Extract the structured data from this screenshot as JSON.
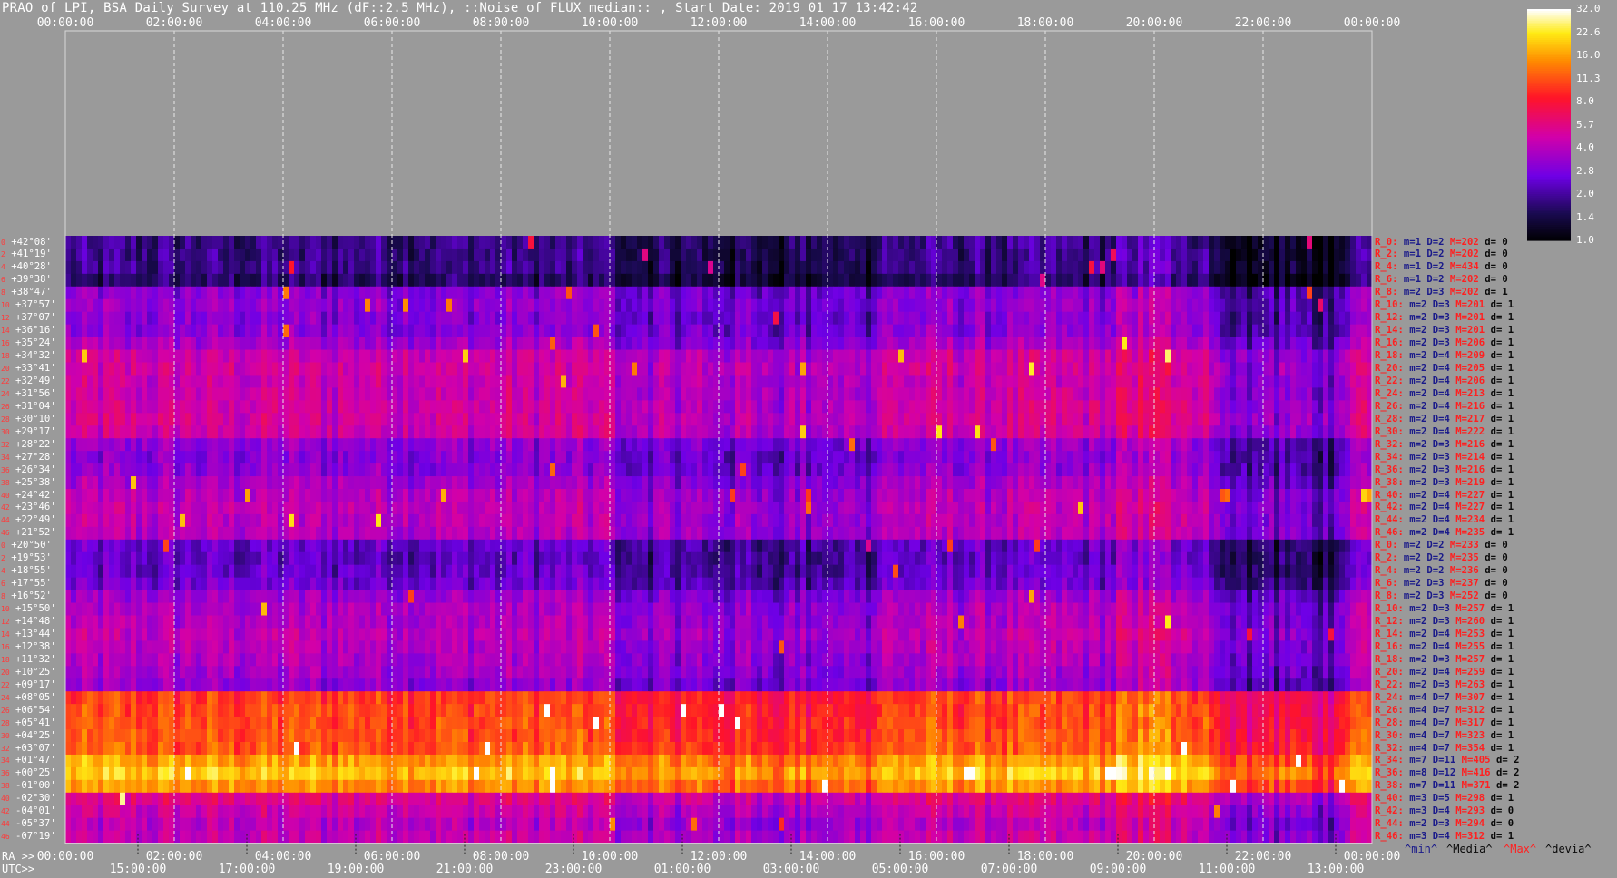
{
  "title": "PRAO of LPI, BSA Daily Survey at 110.25 MHz (dF::2.5 MHz), ::Noise_of_FLUX_median:: , Start Date: 2019 01 17 13:42:42",
  "axes": {
    "top_ticks": [
      "00:00:00",
      "02:00:00",
      "04:00:00",
      "06:00:00",
      "08:00:00",
      "10:00:00",
      "12:00:00",
      "14:00:00",
      "16:00:00",
      "18:00:00",
      "20:00:00",
      "22:00:00",
      "00:00:00"
    ],
    "ra_label": "RA >>",
    "ra_ticks": [
      "00:00:00",
      "02:00:00",
      "04:00:00",
      "06:00:00",
      "08:00:00",
      "10:00:00",
      "12:00:00",
      "14:00:00",
      "16:00:00",
      "18:00:00",
      "20:00:00",
      "22:00:00",
      "00:00:00"
    ],
    "utc_label": "UTC>>",
    "utc_ticks": [
      "15:00:00",
      "17:00:00",
      "19:00:00",
      "21:00:00",
      "23:00:00",
      "01:00:00",
      "03:00:00",
      "05:00:00",
      "07:00:00",
      "09:00:00",
      "11:00:00",
      "13:00:00"
    ]
  },
  "legend": {
    "min": "^min^",
    "media": "^Media^",
    "max": "^Max^",
    "devia": "^devia^"
  },
  "colors": {
    "background": "#9a9a9a",
    "min": "#1a1a8a",
    "max": "#ff2020",
    "text": "#ffffff"
  },
  "colorbar": {
    "labels": [
      "32.0",
      "22.6",
      "16.0",
      "11.3",
      "8.0",
      "5.7",
      "4.0",
      "2.8",
      "2.0",
      "1.4",
      "1.0"
    ]
  },
  "chart_data": {
    "type": "heatmap",
    "title": "PRAO of LPI, BSA Daily Survey at 110.25 MHz (dF::2.5 MHz), ::Noise_of_FLUX_median:: , Start Date: 2019 01 17 13:42:42",
    "x_range": [
      "00:00:00",
      "24:00:00"
    ],
    "colorscale": [
      1.0,
      32.0
    ],
    "rows": [
      {
        "idx": "0",
        "dec": "+42°08'",
        "stat": "R_0:",
        "m": "1",
        "D": "2",
        "M": "202",
        "dv": "0",
        "level": 1.8
      },
      {
        "idx": "2",
        "dec": "+41°19'",
        "stat": "R_2:",
        "m": "1",
        "D": "2",
        "M": "202",
        "dv": "0",
        "level": 1.8
      },
      {
        "idx": "4",
        "dec": "+40°28'",
        "stat": "R_4:",
        "m": "1",
        "D": "2",
        "M": "434",
        "dv": "0",
        "level": 1.8
      },
      {
        "idx": "6",
        "dec": "+39°38'",
        "stat": "R_6:",
        "m": "1",
        "D": "2",
        "M": "202",
        "dv": "0",
        "level": 1.6
      },
      {
        "idx": "8",
        "dec": "+38°47'",
        "stat": "R_8:",
        "m": "2",
        "D": "3",
        "M": "202",
        "dv": "1",
        "level": 3.0
      },
      {
        "idx": "10",
        "dec": "+37°57'",
        "stat": "R_10:",
        "m": "2",
        "D": "3",
        "M": "201",
        "dv": "1",
        "level": 3.2
      },
      {
        "idx": "12",
        "dec": "+37°07'",
        "stat": "R_12:",
        "m": "2",
        "D": "3",
        "M": "201",
        "dv": "1",
        "level": 3.0
      },
      {
        "idx": "14",
        "dec": "+36°16'",
        "stat": "R_14:",
        "m": "2",
        "D": "3",
        "M": "201",
        "dv": "1",
        "level": 3.1
      },
      {
        "idx": "16",
        "dec": "+35°24'",
        "stat": "R_16:",
        "m": "2",
        "D": "3",
        "M": "206",
        "dv": "1",
        "level": 3.6
      },
      {
        "idx": "18",
        "dec": "+34°32'",
        "stat": "R_18:",
        "m": "2",
        "D": "4",
        "M": "209",
        "dv": "1",
        "level": 4.6
      },
      {
        "idx": "20",
        "dec": "+33°41'",
        "stat": "R_20:",
        "m": "2",
        "D": "4",
        "M": "205",
        "dv": "1",
        "level": 4.8
      },
      {
        "idx": "22",
        "dec": "+32°49'",
        "stat": "R_22:",
        "m": "2",
        "D": "4",
        "M": "206",
        "dv": "1",
        "level": 4.5
      },
      {
        "idx": "24",
        "dec": "+31°56'",
        "stat": "R_24:",
        "m": "2",
        "D": "4",
        "M": "213",
        "dv": "1",
        "level": 4.6
      },
      {
        "idx": "26",
        "dec": "+31°04'",
        "stat": "R_26:",
        "m": "2",
        "D": "4",
        "M": "216",
        "dv": "1",
        "level": 4.8
      },
      {
        "idx": "28",
        "dec": "+30°10'",
        "stat": "R_28:",
        "m": "2",
        "D": "4",
        "M": "217",
        "dv": "1",
        "level": 4.9
      },
      {
        "idx": "30",
        "dec": "+29°17'",
        "stat": "R_30:",
        "m": "2",
        "D": "4",
        "M": "222",
        "dv": "1",
        "level": 4.7
      },
      {
        "idx": "32",
        "dec": "+28°22'",
        "stat": "R_32:",
        "m": "2",
        "D": "3",
        "M": "216",
        "dv": "1",
        "level": 3.2
      },
      {
        "idx": "34",
        "dec": "+27°28'",
        "stat": "R_34:",
        "m": "2",
        "D": "3",
        "M": "214",
        "dv": "1",
        "level": 3.0
      },
      {
        "idx": "36",
        "dec": "+26°34'",
        "stat": "R_36:",
        "m": "2",
        "D": "3",
        "M": "216",
        "dv": "1",
        "level": 3.1
      },
      {
        "idx": "38",
        "dec": "+25°38'",
        "stat": "R_38:",
        "m": "2",
        "D": "3",
        "M": "219",
        "dv": "1",
        "level": 3.6
      },
      {
        "idx": "40",
        "dec": "+24°42'",
        "stat": "R_40:",
        "m": "2",
        "D": "4",
        "M": "227",
        "dv": "1",
        "level": 4.0
      },
      {
        "idx": "42",
        "dec": "+23°46'",
        "stat": "R_42:",
        "m": "2",
        "D": "4",
        "M": "227",
        "dv": "1",
        "level": 4.2
      },
      {
        "idx": "44",
        "dec": "+22°49'",
        "stat": "R_44:",
        "m": "2",
        "D": "4",
        "M": "234",
        "dv": "1",
        "level": 4.1
      },
      {
        "idx": "46",
        "dec": "+21°52'",
        "stat": "R_46:",
        "m": "2",
        "D": "4",
        "M": "235",
        "dv": "1",
        "level": 4.0
      },
      {
        "idx": "0",
        "dec": "+20°50'",
        "stat": "R_0:",
        "m": "2",
        "D": "2",
        "M": "233",
        "dv": "0",
        "level": 2.4
      },
      {
        "idx": "2",
        "dec": "+19°53'",
        "stat": "R_2:",
        "m": "2",
        "D": "2",
        "M": "235",
        "dv": "0",
        "level": 2.3
      },
      {
        "idx": "4",
        "dec": "+18°55'",
        "stat": "R_4:",
        "m": "2",
        "D": "2",
        "M": "236",
        "dv": "0",
        "level": 2.4
      },
      {
        "idx": "6",
        "dec": "+17°55'",
        "stat": "R_6:",
        "m": "2",
        "D": "3",
        "M": "237",
        "dv": "0",
        "level": 2.6
      },
      {
        "idx": "8",
        "dec": "+16°52'",
        "stat": "R_8:",
        "m": "2",
        "D": "3",
        "M": "252",
        "dv": "0",
        "level": 3.4
      },
      {
        "idx": "10",
        "dec": "+15°50'",
        "stat": "R_10:",
        "m": "2",
        "D": "3",
        "M": "257",
        "dv": "1",
        "level": 3.8
      },
      {
        "idx": "12",
        "dec": "+14°48'",
        "stat": "R_12:",
        "m": "2",
        "D": "3",
        "M": "260",
        "dv": "1",
        "level": 3.9
      },
      {
        "idx": "14",
        "dec": "+13°44'",
        "stat": "R_14:",
        "m": "2",
        "D": "4",
        "M": "253",
        "dv": "1",
        "level": 4.2
      },
      {
        "idx": "16",
        "dec": "+12°38'",
        "stat": "R_16:",
        "m": "2",
        "D": "4",
        "M": "255",
        "dv": "1",
        "level": 4.0
      },
      {
        "idx": "18",
        "dec": "+11°32'",
        "stat": "R_18:",
        "m": "2",
        "D": "3",
        "M": "257",
        "dv": "1",
        "level": 3.8
      },
      {
        "idx": "20",
        "dec": "+10°25'",
        "stat": "R_20:",
        "m": "2",
        "D": "4",
        "M": "259",
        "dv": "1",
        "level": 3.6
      },
      {
        "idx": "22",
        "dec": "+09°17'",
        "stat": "R_22:",
        "m": "2",
        "D": "3",
        "M": "263",
        "dv": "1",
        "level": 3.2
      },
      {
        "idx": "24",
        "dec": "+08°05'",
        "stat": "R_24:",
        "m": "4",
        "D": "7",
        "M": "307",
        "dv": "1",
        "level": 10.0
      },
      {
        "idx": "26",
        "dec": "+06°54'",
        "stat": "R_26:",
        "m": "4",
        "D": "7",
        "M": "312",
        "dv": "1",
        "level": 10.5
      },
      {
        "idx": "28",
        "dec": "+05°41'",
        "stat": "R_28:",
        "m": "4",
        "D": "7",
        "M": "317",
        "dv": "1",
        "level": 10.8
      },
      {
        "idx": "30",
        "dec": "+04°25'",
        "stat": "R_30:",
        "m": "4",
        "D": "7",
        "M": "323",
        "dv": "1",
        "level": 11.0
      },
      {
        "idx": "32",
        "dec": "+03°07'",
        "stat": "R_32:",
        "m": "4",
        "D": "7",
        "M": "354",
        "dv": "1",
        "level": 11.5
      },
      {
        "idx": "34",
        "dec": "+01°47'",
        "stat": "R_34:",
        "m": "7",
        "D": "11",
        "M": "405",
        "dv": "2",
        "level": 16.0
      },
      {
        "idx": "36",
        "dec": "+00°25'",
        "stat": "R_36:",
        "m": "8",
        "D": "12",
        "M": "416",
        "dv": "2",
        "level": 19.0
      },
      {
        "idx": "38",
        "dec": "-01°00'",
        "stat": "R_38:",
        "m": "7",
        "D": "11",
        "M": "371",
        "dv": "2",
        "level": 15.0
      },
      {
        "idx": "40",
        "dec": "-02°30'",
        "stat": "R_40:",
        "m": "3",
        "D": "5",
        "M": "298",
        "dv": "1",
        "level": 5.5
      },
      {
        "idx": "42",
        "dec": "-04°01'",
        "stat": "R_42:",
        "m": "3",
        "D": "4",
        "M": "293",
        "dv": "0",
        "level": 4.6
      },
      {
        "idx": "44",
        "dec": "-05°37'",
        "stat": "R_44:",
        "m": "2",
        "D": "3",
        "M": "294",
        "dv": "0",
        "level": 4.0
      },
      {
        "idx": "46",
        "dec": "-07°19'",
        "stat": "R_46:",
        "m": "3",
        "D": "4",
        "M": "312",
        "dv": "1",
        "level": 4.4
      }
    ]
  }
}
